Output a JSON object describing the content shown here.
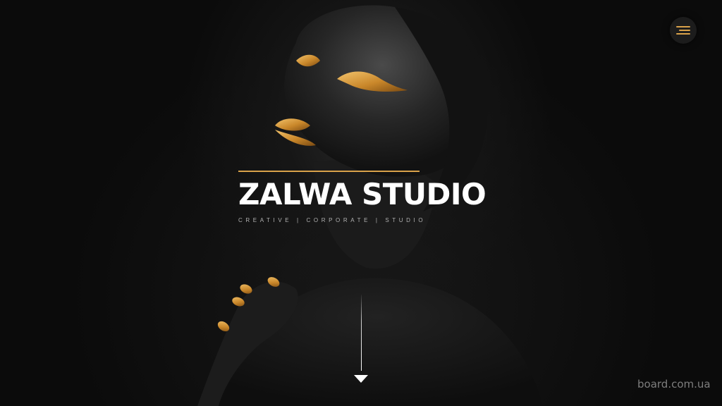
{
  "hero": {
    "title": "ZALWA STUDIO",
    "tagline": "CREATIVE | CORPORATE | STUDIO"
  },
  "menu": {
    "icon": "hamburger-menu-icon"
  },
  "scroll": {
    "icon": "scroll-down-arrow-icon"
  },
  "watermark": {
    "text": "board.com.ua"
  },
  "colors": {
    "accent": "#d9a24a",
    "background": "#0b0b0b",
    "title": "#ffffff"
  }
}
